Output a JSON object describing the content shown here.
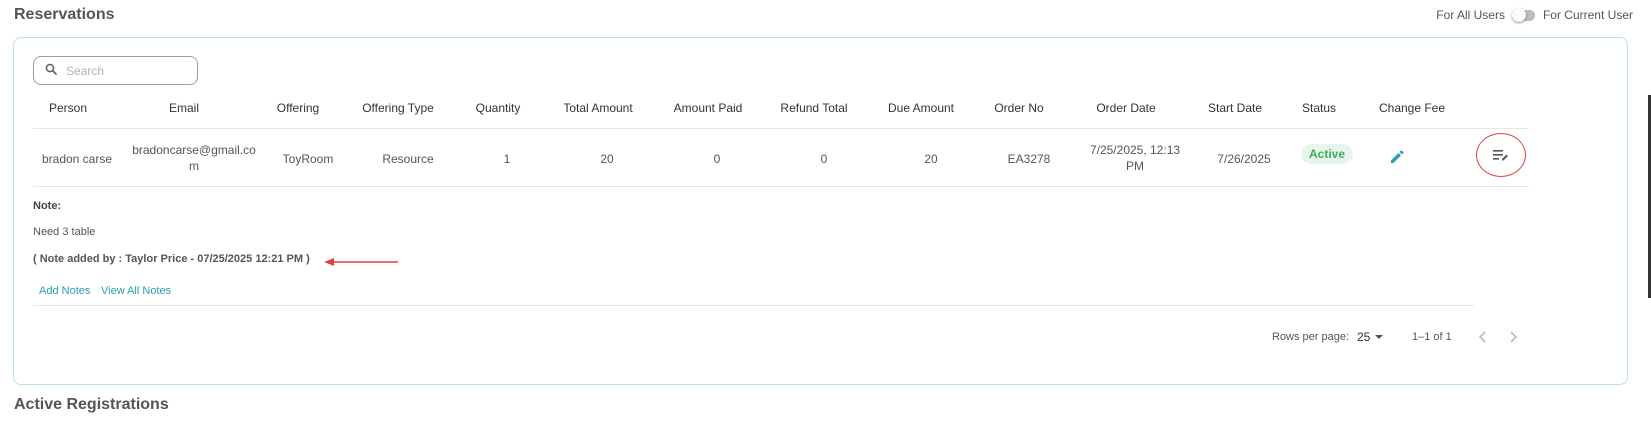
{
  "page": {
    "title": "Reservations",
    "next_section_title": "Active Registrations"
  },
  "toggle": {
    "left_label": "For All Users",
    "right_label": "For Current User",
    "state": "off"
  },
  "search": {
    "placeholder": "Search",
    "value": ""
  },
  "table": {
    "headers": {
      "person": "Person",
      "email": "Email",
      "offering": "Offering",
      "offering_type": "Offering Type",
      "quantity": "Quantity",
      "total_amount": "Total Amount",
      "amount_paid": "Amount Paid",
      "refund_total": "Refund Total",
      "due_amount": "Due Amount",
      "order_no": "Order No",
      "order_date": "Order Date",
      "start_date": "Start Date",
      "status": "Status",
      "change_fee": "Change Fee"
    },
    "row": {
      "person": "bradon carse",
      "email_line1": "bradoncarse@gmail.co",
      "email_line2": "m",
      "offering": "ToyRoom",
      "offering_type": "Resource",
      "quantity": "1",
      "total_amount": "20",
      "amount_paid": "0",
      "refund_total": "0",
      "due_amount": "20",
      "order_no": "EA3278",
      "order_date_line1": "7/25/2025, 12:13",
      "order_date_line2": "PM",
      "start_date": "7/26/2025",
      "status": "Active",
      "icons": {
        "change_fee": "pencil-icon",
        "notes": "notes-edit-icon"
      }
    }
  },
  "note": {
    "label": "Note:",
    "text": "Need 3 table",
    "added_by": "( Note added by : Taylor Price - 07/25/2025 12:21 PM )",
    "add_link": "Add Notes",
    "view_link": "View All Notes"
  },
  "pagination": {
    "rows_label": "Rows per page:",
    "rows_value": "25",
    "range": "1–1 of 1"
  },
  "colors": {
    "accent": "#2aa0b0",
    "status_active": "#3fae5b",
    "highlight": "#e04040",
    "card_border": "#b9e3ea"
  }
}
